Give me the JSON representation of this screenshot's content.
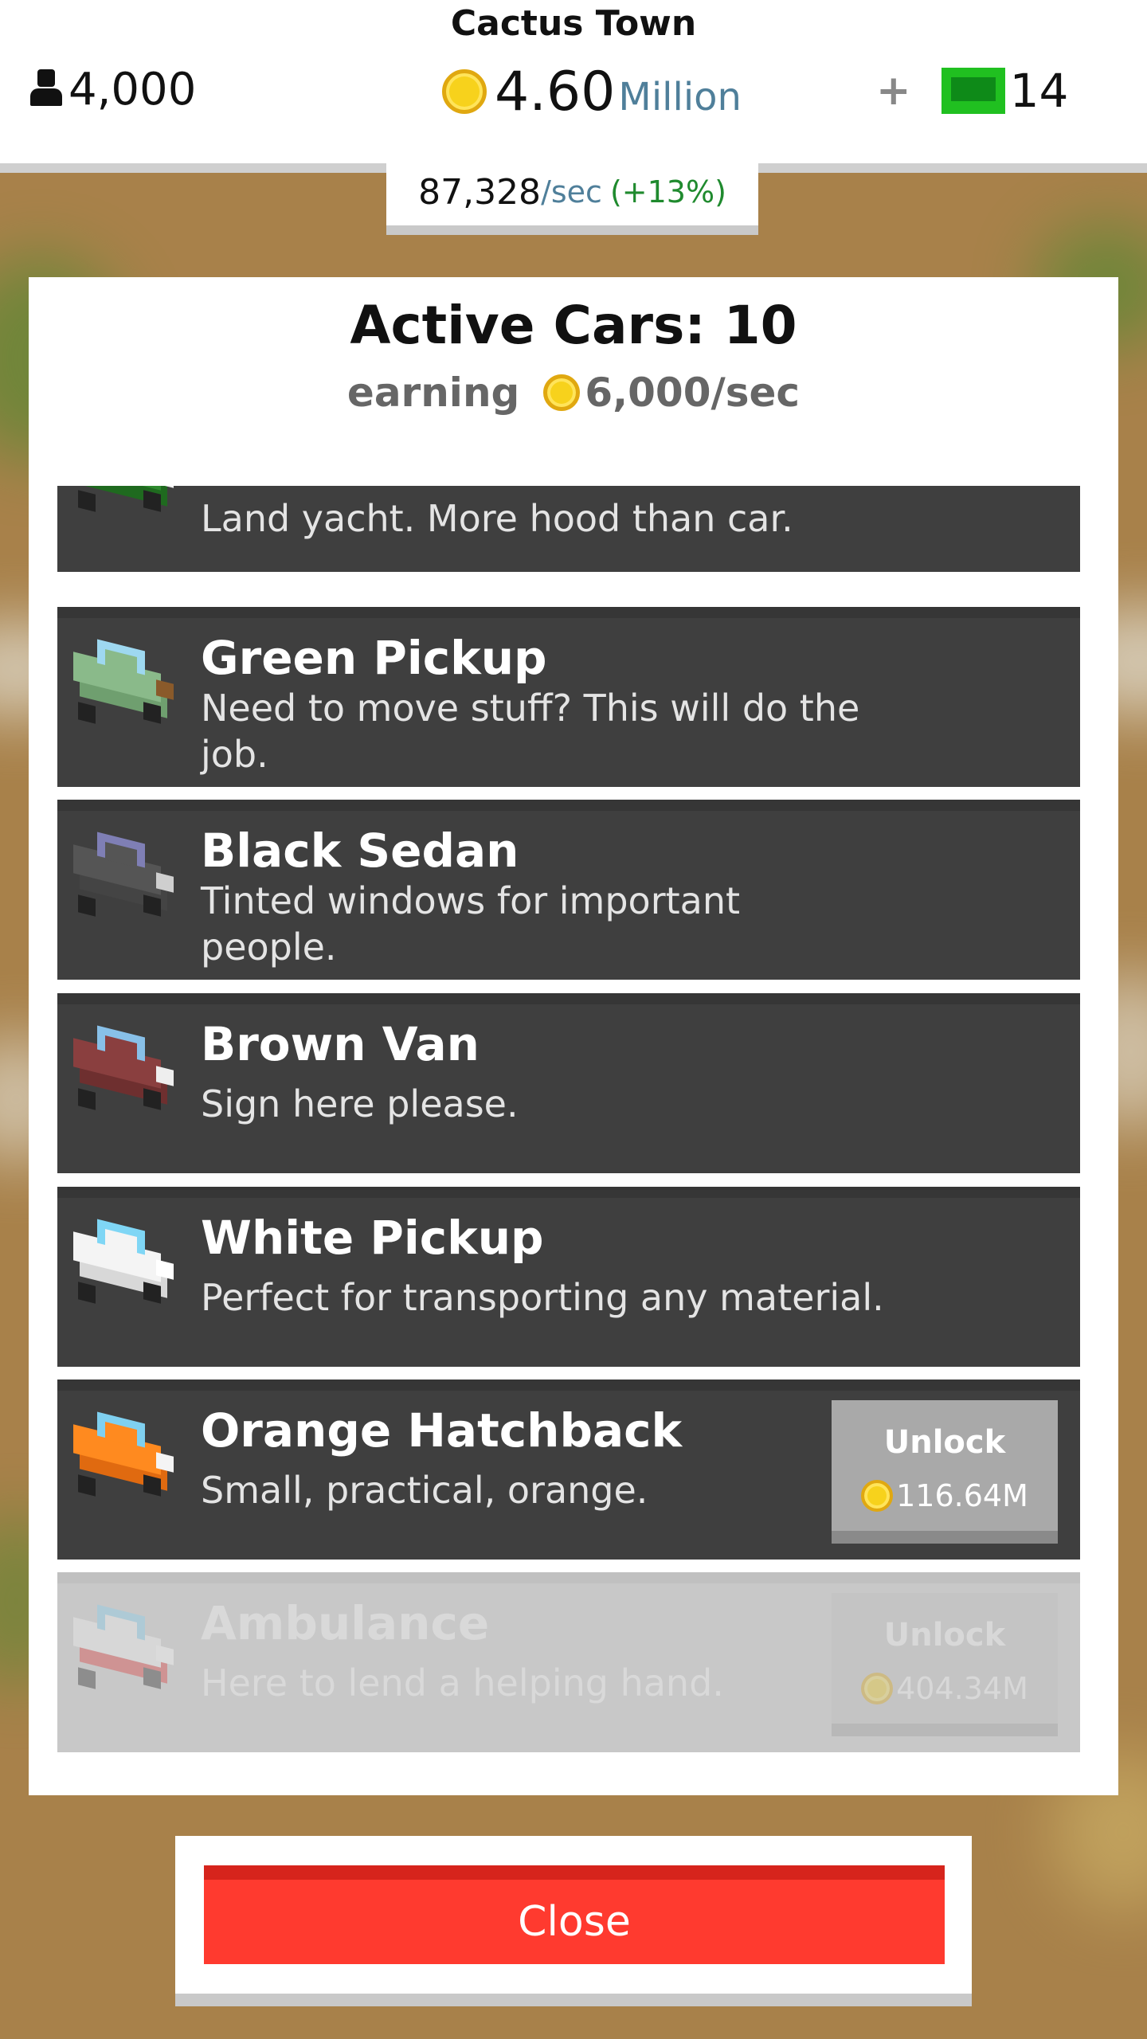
{
  "header": {
    "city_name": "Cactus Town",
    "population": "4,000",
    "money_amount": "4.60",
    "money_unit": "Million",
    "gems": "14",
    "rate_value": "87,328",
    "rate_unit": "/sec",
    "rate_bonus": "(+13%)",
    "icons": {
      "population": "person-icon",
      "money": "coin-icon",
      "add": "plus-icon",
      "gems": "gem-icon"
    }
  },
  "panel": {
    "title": "Active Cars: 10",
    "earning_label": "earning",
    "earning_value": "6,000/sec"
  },
  "cars": [
    {
      "name": "",
      "desc": "Land yacht. More hood than car.",
      "colors": [
        "#2e8a2e",
        "#1f6a1f",
        "#4aa0d8",
        "#f0f0f0"
      ]
    },
    {
      "name": "Green Pickup",
      "desc": "Need to move stuff? This will do the job.",
      "colors": [
        "#8aba8a",
        "#6f9f6f",
        "#9ed8f0",
        "#8a5a2a"
      ]
    },
    {
      "name": "Black Sedan",
      "desc": "Tinted windows for important people.",
      "colors": [
        "#555555",
        "#444444",
        "#7f7fb5",
        "#cfcfcf"
      ]
    },
    {
      "name": "Brown Van",
      "desc": "Sign here please.",
      "colors": [
        "#8a3f3f",
        "#6e2f2f",
        "#88c0e8",
        "#eeeeee"
      ]
    },
    {
      "name": "White Pickup",
      "desc": "Perfect for transporting any material.",
      "colors": [
        "#f4f4f4",
        "#d8d8d8",
        "#7fd6f5",
        "#ffffff"
      ]
    },
    {
      "name": "Orange Hatchback",
      "desc": "Small, practical, orange.",
      "colors": [
        "#ff8a1f",
        "#e06a10",
        "#7fd0f0",
        "#f4f4f4"
      ],
      "unlock_label": "Unlock",
      "price": "116.64M"
    },
    {
      "name": "Ambulance",
      "desc": "Here to lend a helping hand.",
      "colors": [
        "#f4f4f4",
        "#dd3333",
        "#7fd0f0",
        "#ffffff"
      ],
      "unlock_label": "Unlock",
      "price": "404.34M"
    }
  ],
  "close_label": "Close"
}
